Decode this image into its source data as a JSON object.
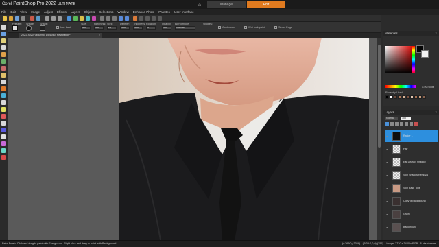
{
  "app": {
    "title_corel": "Corel",
    "title_main": "PaintShop Pro 2022",
    "title_edition": "ULTIMATE"
  },
  "workspace_tabs": [
    {
      "label": "Manage",
      "active": false
    },
    {
      "label": "Edit",
      "active": true
    }
  ],
  "menu": [
    "File",
    "Edit",
    "View",
    "Image",
    "Adjust",
    "Effects",
    "Layers",
    "Objects",
    "Selections",
    "Window",
    "Enhance Photo",
    "Palettes",
    "User Interface"
  ],
  "options": {
    "presets_label": "Presets:",
    "shape_label": "Shape:",
    "size_label": "Size:",
    "size_value": "500",
    "hardness_label": "Hardness:",
    "hardness_value": "100",
    "step_label": "Step:",
    "step_value": "25",
    "density_label": "Density:",
    "density_value": "100",
    "thickness_label": "Thickness:",
    "thickness_value": "100",
    "rotation_label": "Rotation:",
    "rotation_value": "0",
    "opacity_label": "Opacity:",
    "opacity_value": "100",
    "blend_label": "Blend mode:",
    "blend_value": "Normal",
    "strokes_label": "Strokes:",
    "continuous": "Continuous",
    "wet_look": "Wet look paint",
    "smart_edge": "Smart Edge",
    "use_last_label": "Use Last"
  },
  "document": {
    "tab_title": "20211902070ba0995_1401060_Restoration*",
    "zoom": "100%"
  },
  "status": {
    "left": "Paint Brush: Click and drag to paint with Foreground. Right-click and drag to paint with Background.",
    "right": "(x:2660 y:3368) - (RGB:0,0,0) (255) -- Image: 2730 x 3440 x RGB - 8 bits/channel"
  },
  "materials": {
    "title": "Materials",
    "recently_used": "Recently Used",
    "all_tools": "All tools",
    "fg_color": "#050505",
    "bg_color": "#f4f4f4",
    "recent_colors": [
      "#000000",
      "#ffffff",
      "#6b4a3a",
      "#b07a5a",
      "#d9b59a",
      "#7a5040",
      "#e2c7b2",
      "#a36f52",
      "#c9a080",
      "#8a6450"
    ]
  },
  "layers": {
    "title": "Layers",
    "blend": "Normal",
    "opacity": "100",
    "items": [
      {
        "name": "Raster 1",
        "selected": true
      },
      {
        "name": "Hair",
        "selected": false
      },
      {
        "name": "Ear Distract Shadow",
        "selected": false
      },
      {
        "name": "Skin Shadow Removal",
        "selected": false
      },
      {
        "name": "Skin Ease Tone",
        "selected": false
      },
      {
        "name": "Copy of Background",
        "selected": false
      },
      {
        "name": "Grain",
        "selected": false
      },
      {
        "name": "Background",
        "selected": false
      }
    ]
  }
}
